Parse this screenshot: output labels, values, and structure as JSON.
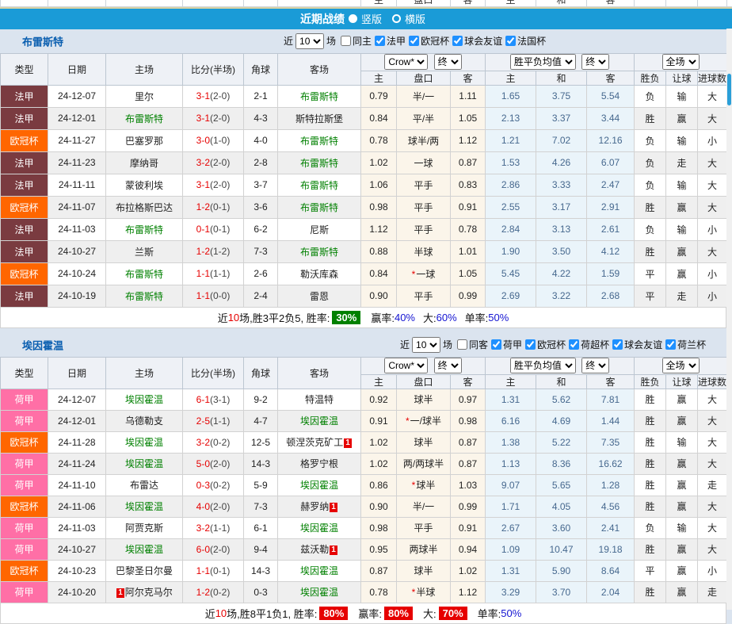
{
  "header": {
    "title": "近期战绩",
    "radio_vertical": "竖版",
    "radio_horizontal": "横版"
  },
  "top_strip": {
    "labels": [
      "主",
      "盘口",
      "客",
      "主",
      "和",
      "客"
    ]
  },
  "columns": {
    "main": [
      "类型",
      "日期",
      "主场",
      "比分(半场)",
      "角球",
      "客场"
    ],
    "sub": [
      "主",
      "盘口",
      "客",
      "主",
      "和",
      "客",
      "胜负",
      "让球",
      "进球数"
    ],
    "select_crow": "Crow*",
    "select_final": "终",
    "select_mean": "胜平负均值",
    "select_scope": "全场"
  },
  "filter": {
    "near": "近",
    "matches": "场"
  },
  "colors": {
    "header_blue": "#1a9bd7",
    "ligue1_badge": "#7a3b40",
    "ucl_badge": "#ff6600",
    "eredivisie_badge": "#ff6fa6",
    "win_red": "#e60000",
    "lose_green": "#008000",
    "draw_blue": "#1414d2",
    "team_link_green": "#008000",
    "odds_bg": "#fbf5ea",
    "mean_bg": "#eaf4fa"
  },
  "tables": [
    {
      "team": "布雷斯特",
      "count": "10",
      "same_label": "同主",
      "leagues": [
        {
          "label": "法甲"
        },
        {
          "label": "欧冠杯"
        },
        {
          "label": "球会友谊"
        },
        {
          "label": "法国杯"
        }
      ],
      "rows": [
        {
          "type": "法甲",
          "type_cls": "t-fa",
          "date": "24-12-07",
          "home_badge": "",
          "home": "里尔",
          "home_cls": "",
          "score": "3-1",
          "half": "(2-0)",
          "corner": "2-1",
          "away": "布雷斯特",
          "away_cls": "green",
          "away_badge": "",
          "odds_home": "0.79",
          "pan_star": "",
          "pan": "半/一",
          "odds_away": "1.11",
          "mean_home": "1.65",
          "mean_draw": "3.75",
          "mean_away": "5.54",
          "wdl": "负",
          "wdl_cls": "green",
          "handicap": "输",
          "handicap_cls": "green",
          "goals": "大",
          "goals_cls": "red"
        },
        {
          "type": "法甲",
          "type_cls": "t-fa",
          "date": "24-12-01",
          "home_badge": "",
          "home": "布雷斯特",
          "home_cls": "green",
          "score": "3-1",
          "half": "(2-0)",
          "corner": "4-3",
          "away": "斯特拉斯堡",
          "away_cls": "",
          "away_badge": "",
          "odds_home": "0.84",
          "pan_star": "",
          "pan": "平/半",
          "odds_away": "1.05",
          "mean_home": "2.13",
          "mean_draw": "3.37",
          "mean_away": "3.44",
          "wdl": "胜",
          "wdl_cls": "red",
          "handicap": "赢",
          "handicap_cls": "red",
          "goals": "大",
          "goals_cls": "red"
        },
        {
          "type": "欧冠杯",
          "type_cls": "t-ou",
          "date": "24-11-27",
          "home_badge": "",
          "home": "巴塞罗那",
          "home_cls": "",
          "score": "3-0",
          "half": "(1-0)",
          "corner": "4-0",
          "away": "布雷斯特",
          "away_cls": "green",
          "away_badge": "",
          "odds_home": "0.78",
          "pan_star": "",
          "pan": "球半/两",
          "odds_away": "1.12",
          "mean_home": "1.21",
          "mean_draw": "7.02",
          "mean_away": "12.16",
          "wdl": "负",
          "wdl_cls": "green",
          "handicap": "输",
          "handicap_cls": "green",
          "goals": "小",
          "goals_cls": "green"
        },
        {
          "type": "法甲",
          "type_cls": "t-fa",
          "date": "24-11-23",
          "home_badge": "",
          "home": "摩纳哥",
          "home_cls": "",
          "score": "3-2",
          "half": "(2-0)",
          "corner": "2-8",
          "away": "布雷斯特",
          "away_cls": "green",
          "away_badge": "",
          "odds_home": "1.02",
          "pan_star": "",
          "pan": "一球",
          "odds_away": "0.87",
          "mean_home": "1.53",
          "mean_draw": "4.26",
          "mean_away": "6.07",
          "wdl": "负",
          "wdl_cls": "green",
          "handicap": "走",
          "handicap_cls": "blue",
          "goals": "大",
          "goals_cls": "red"
        },
        {
          "type": "法甲",
          "type_cls": "t-fa",
          "date": "24-11-11",
          "home_badge": "",
          "home": "蒙彼利埃",
          "home_cls": "",
          "score": "3-1",
          "half": "(2-0)",
          "corner": "3-7",
          "away": "布雷斯特",
          "away_cls": "green",
          "away_badge": "",
          "odds_home": "1.06",
          "pan_star": "",
          "pan": "平手",
          "odds_away": "0.83",
          "mean_home": "2.86",
          "mean_draw": "3.33",
          "mean_away": "2.47",
          "wdl": "负",
          "wdl_cls": "green",
          "handicap": "输",
          "handicap_cls": "green",
          "goals": "大",
          "goals_cls": "red"
        },
        {
          "type": "欧冠杯",
          "type_cls": "t-ou",
          "date": "24-11-07",
          "home_badge": "",
          "home": "布拉格斯巴达",
          "home_cls": "",
          "score": "1-2",
          "half": "(0-1)",
          "corner": "3-6",
          "away": "布雷斯特",
          "away_cls": "green",
          "away_badge": "",
          "odds_home": "0.98",
          "pan_star": "",
          "pan": "平手",
          "odds_away": "0.91",
          "mean_home": "2.55",
          "mean_draw": "3.17",
          "mean_away": "2.91",
          "wdl": "胜",
          "wdl_cls": "red",
          "handicap": "赢",
          "handicap_cls": "red",
          "goals": "大",
          "goals_cls": "red"
        },
        {
          "type": "法甲",
          "type_cls": "t-fa",
          "date": "24-11-03",
          "home_badge": "",
          "home": "布雷斯特",
          "home_cls": "green",
          "score": "0-1",
          "half": "(0-1)",
          "corner": "6-2",
          "away": "尼斯",
          "away_cls": "",
          "away_badge": "",
          "odds_home": "1.12",
          "pan_star": "",
          "pan": "平手",
          "odds_away": "0.78",
          "mean_home": "2.84",
          "mean_draw": "3.13",
          "mean_away": "2.61",
          "wdl": "负",
          "wdl_cls": "green",
          "handicap": "输",
          "handicap_cls": "green",
          "goals": "小",
          "goals_cls": "green"
        },
        {
          "type": "法甲",
          "type_cls": "t-fa",
          "date": "24-10-27",
          "home_badge": "",
          "home": "兰斯",
          "home_cls": "",
          "score": "1-2",
          "half": "(1-2)",
          "corner": "7-3",
          "away": "布雷斯特",
          "away_cls": "green",
          "away_badge": "",
          "odds_home": "0.88",
          "pan_star": "",
          "pan": "半球",
          "odds_away": "1.01",
          "mean_home": "1.90",
          "mean_draw": "3.50",
          "mean_away": "4.12",
          "wdl": "胜",
          "wdl_cls": "red",
          "handicap": "赢",
          "handicap_cls": "red",
          "goals": "大",
          "goals_cls": "red"
        },
        {
          "type": "欧冠杯",
          "type_cls": "t-ou",
          "date": "24-10-24",
          "home_badge": "",
          "home": "布雷斯特",
          "home_cls": "green",
          "score": "1-1",
          "half": "(1-1)",
          "corner": "2-6",
          "away": "勒沃库森",
          "away_cls": "",
          "away_badge": "",
          "odds_home": "0.84",
          "pan_star": "*",
          "pan": "一球",
          "odds_away": "1.05",
          "mean_home": "5.45",
          "mean_draw": "4.22",
          "mean_away": "1.59",
          "wdl": "平",
          "wdl_cls": "blue",
          "handicap": "赢",
          "handicap_cls": "red",
          "goals": "小",
          "goals_cls": "green"
        },
        {
          "type": "法甲",
          "type_cls": "t-fa",
          "date": "24-10-19",
          "home_badge": "",
          "home": "布雷斯特",
          "home_cls": "green",
          "score": "1-1",
          "half": "(0-0)",
          "corner": "2-4",
          "away": "雷恩",
          "away_cls": "",
          "away_badge": "",
          "odds_home": "0.90",
          "pan_star": "",
          "pan": "平手",
          "odds_away": "0.99",
          "mean_home": "2.69",
          "mean_draw": "3.22",
          "mean_away": "2.68",
          "wdl": "平",
          "wdl_cls": "blue",
          "handicap": "走",
          "handicap_cls": "blue",
          "goals": "小",
          "goals_cls": "green"
        }
      ],
      "summary": {
        "near_label": "近",
        "n": "10",
        "mid": "场,胜3平2负5, 胜率:",
        "rate": "30%",
        "rate_cls": "pct-green",
        "w_label": "赢率:",
        "w_value": "40%",
        "w_cls": "val-blue",
        "b_label": "大:",
        "b_value": "60%",
        "b_cls": "val-blue",
        "s_label": "单率:",
        "s_value": "50%",
        "s_cls": "val-blue"
      }
    },
    {
      "team": "埃因霍温",
      "count": "10",
      "same_label": "同客",
      "leagues": [
        {
          "label": "荷甲"
        },
        {
          "label": "欧冠杯"
        },
        {
          "label": "荷超杯"
        },
        {
          "label": "球会友谊"
        },
        {
          "label": "荷兰杯"
        }
      ],
      "rows": [
        {
          "type": "荷甲",
          "type_cls": "t-he",
          "date": "24-12-07",
          "home_badge": "",
          "home": "埃因霍温",
          "home_cls": "green",
          "score": "6-1",
          "half": "(3-1)",
          "corner": "9-2",
          "away": "特温特",
          "away_cls": "",
          "away_badge": "",
          "odds_home": "0.92",
          "pan_star": "",
          "pan": "球半",
          "odds_away": "0.97",
          "mean_home": "1.31",
          "mean_draw": "5.62",
          "mean_away": "7.81",
          "wdl": "胜",
          "wdl_cls": "red",
          "handicap": "赢",
          "handicap_cls": "red",
          "goals": "大",
          "goals_cls": "red"
        },
        {
          "type": "荷甲",
          "type_cls": "t-he",
          "date": "24-12-01",
          "home_badge": "",
          "home": "乌德勒支",
          "home_cls": "",
          "score": "2-5",
          "half": "(1-1)",
          "corner": "4-7",
          "away": "埃因霍温",
          "away_cls": "green",
          "away_badge": "",
          "odds_home": "0.91",
          "pan_star": "*",
          "pan": "一/球半",
          "odds_away": "0.98",
          "mean_home": "6.16",
          "mean_draw": "4.69",
          "mean_away": "1.44",
          "wdl": "胜",
          "wdl_cls": "red",
          "handicap": "赢",
          "handicap_cls": "red",
          "goals": "大",
          "goals_cls": "red"
        },
        {
          "type": "欧冠杯",
          "type_cls": "t-ou",
          "date": "24-11-28",
          "home_badge": "",
          "home": "埃因霍温",
          "home_cls": "green",
          "score": "3-2",
          "half": "(0-2)",
          "corner": "12-5",
          "away": "顿涅茨克矿工",
          "away_cls": "",
          "away_badge": "1",
          "odds_home": "1.02",
          "pan_star": "",
          "pan": "球半",
          "odds_away": "0.87",
          "mean_home": "1.38",
          "mean_draw": "5.22",
          "mean_away": "7.35",
          "wdl": "胜",
          "wdl_cls": "red",
          "handicap": "输",
          "handicap_cls": "green",
          "goals": "大",
          "goals_cls": "red"
        },
        {
          "type": "荷甲",
          "type_cls": "t-he",
          "date": "24-11-24",
          "home_badge": "",
          "home": "埃因霍温",
          "home_cls": "green",
          "score": "5-0",
          "half": "(2-0)",
          "corner": "14-3",
          "away": "格罗宁根",
          "away_cls": "",
          "away_badge": "",
          "odds_home": "1.02",
          "pan_star": "",
          "pan": "两/两球半",
          "odds_away": "0.87",
          "mean_home": "1.13",
          "mean_draw": "8.36",
          "mean_away": "16.62",
          "wdl": "胜",
          "wdl_cls": "red",
          "handicap": "赢",
          "handicap_cls": "red",
          "goals": "大",
          "goals_cls": "red"
        },
        {
          "type": "荷甲",
          "type_cls": "t-he",
          "date": "24-11-10",
          "home_badge": "",
          "home": "布雷达",
          "home_cls": "",
          "score": "0-3",
          "half": "(0-2)",
          "corner": "5-9",
          "away": "埃因霍温",
          "away_cls": "green",
          "away_badge": "",
          "odds_home": "0.86",
          "pan_star": "*",
          "pan": "球半",
          "odds_away": "1.03",
          "mean_home": "9.07",
          "mean_draw": "5.65",
          "mean_away": "1.28",
          "wdl": "胜",
          "wdl_cls": "red",
          "handicap": "赢",
          "handicap_cls": "red",
          "goals": "走",
          "goals_cls": "blue"
        },
        {
          "type": "欧冠杯",
          "type_cls": "t-ou",
          "date": "24-11-06",
          "home_badge": "",
          "home": "埃因霍温",
          "home_cls": "green",
          "score": "4-0",
          "half": "(2-0)",
          "corner": "7-3",
          "away": "赫罗纳",
          "away_cls": "",
          "away_badge": "1",
          "odds_home": "0.90",
          "pan_star": "",
          "pan": "半/一",
          "odds_away": "0.99",
          "mean_home": "1.71",
          "mean_draw": "4.05",
          "mean_away": "4.56",
          "wdl": "胜",
          "wdl_cls": "red",
          "handicap": "赢",
          "handicap_cls": "red",
          "goals": "大",
          "goals_cls": "red"
        },
        {
          "type": "荷甲",
          "type_cls": "t-he",
          "date": "24-11-03",
          "home_badge": "",
          "home": "阿贾克斯",
          "home_cls": "",
          "score": "3-2",
          "half": "(1-1)",
          "corner": "6-1",
          "away": "埃因霍温",
          "away_cls": "green",
          "away_badge": "",
          "odds_home": "0.98",
          "pan_star": "",
          "pan": "平手",
          "odds_away": "0.91",
          "mean_home": "2.67",
          "mean_draw": "3.60",
          "mean_away": "2.41",
          "wdl": "负",
          "wdl_cls": "green",
          "handicap": "输",
          "handicap_cls": "green",
          "goals": "大",
          "goals_cls": "red"
        },
        {
          "type": "荷甲",
          "type_cls": "t-he",
          "date": "24-10-27",
          "home_badge": "",
          "home": "埃因霍温",
          "home_cls": "green",
          "score": "6-0",
          "half": "(2-0)",
          "corner": "9-4",
          "away": "兹沃勒",
          "away_cls": "",
          "away_badge": "1",
          "odds_home": "0.95",
          "pan_star": "",
          "pan": "两球半",
          "odds_away": "0.94",
          "mean_home": "1.09",
          "mean_draw": "10.47",
          "mean_away": "19.18",
          "wdl": "胜",
          "wdl_cls": "red",
          "handicap": "赢",
          "handicap_cls": "red",
          "goals": "大",
          "goals_cls": "red"
        },
        {
          "type": "欧冠杯",
          "type_cls": "t-ou",
          "date": "24-10-23",
          "home_badge": "",
          "home": "巴黎圣日尔曼",
          "home_cls": "",
          "score": "1-1",
          "half": "(0-1)",
          "corner": "14-3",
          "away": "埃因霍温",
          "away_cls": "green",
          "away_badge": "",
          "odds_home": "0.87",
          "pan_star": "",
          "pan": "球半",
          "odds_away": "1.02",
          "mean_home": "1.31",
          "mean_draw": "5.90",
          "mean_away": "8.64",
          "wdl": "平",
          "wdl_cls": "blue",
          "handicap": "赢",
          "handicap_cls": "red",
          "goals": "小",
          "goals_cls": "green"
        },
        {
          "type": "荷甲",
          "type_cls": "t-he",
          "date": "24-10-20",
          "home_badge": "1",
          "home": "阿尔克马尔",
          "home_cls": "",
          "score": "1-2",
          "half": "(0-2)",
          "corner": "0-3",
          "away": "埃因霍温",
          "away_cls": "green",
          "away_badge": "",
          "odds_home": "0.78",
          "pan_star": "*",
          "pan": "半球",
          "odds_away": "1.12",
          "mean_home": "3.29",
          "mean_draw": "3.70",
          "mean_away": "2.04",
          "wdl": "胜",
          "wdl_cls": "red",
          "handicap": "赢",
          "handicap_cls": "red",
          "goals": "走",
          "goals_cls": "blue"
        }
      ],
      "summary": {
        "near_label": "近",
        "n": "10",
        "mid": "场,胜8平1负1, 胜率:",
        "rate": "80%",
        "rate_cls": "pct-red",
        "w_label": "赢率:",
        "w_value": "80%",
        "w_cls": "pct-red",
        "b_label": "大:",
        "b_value": "70%",
        "b_cls": "pct-red",
        "s_label": "单率:",
        "s_value": "50%",
        "s_cls": "val-blue"
      }
    }
  ]
}
